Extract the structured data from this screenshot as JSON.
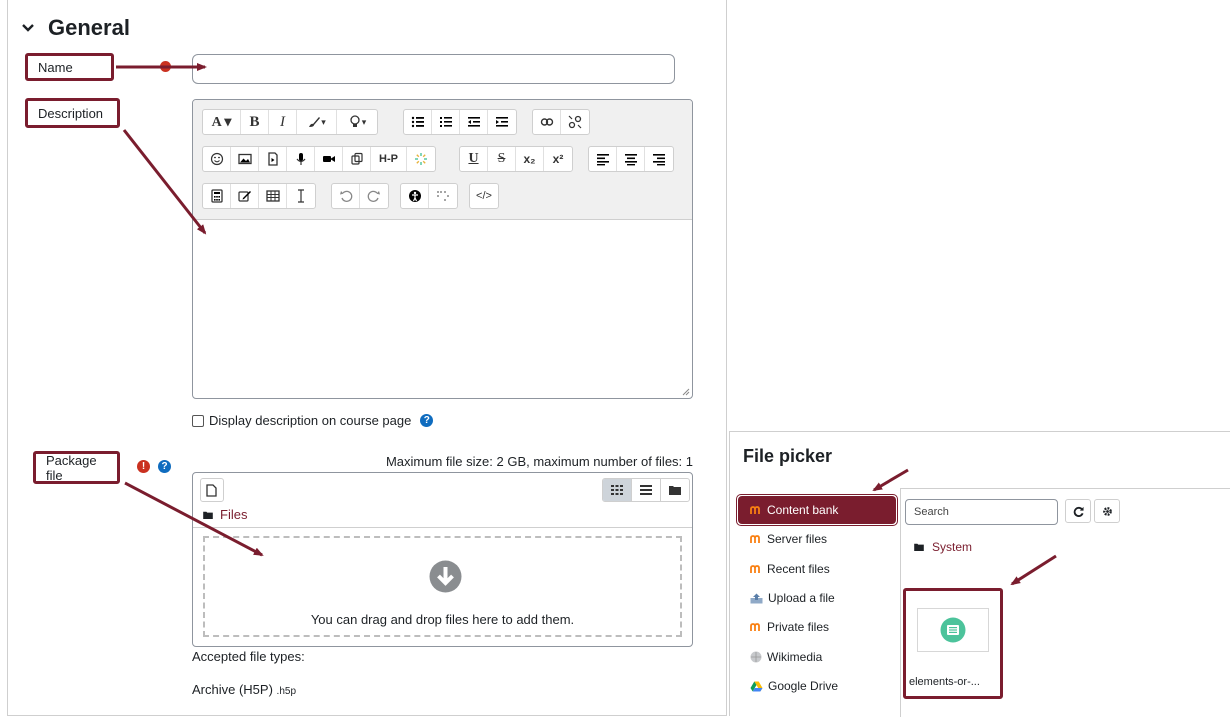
{
  "general": {
    "section_title": "General",
    "name_label": "Name",
    "name_value": "",
    "description_label": "Description",
    "display_description_label": "Display description on course page",
    "package_file_label": "Package file",
    "max_file_text": "Maximum file size: 2 GB, maximum number of files: 1",
    "files_path": "Files",
    "drop_text": "You can drag and drop files here to add them.",
    "accepted_types_label": "Accepted file types:",
    "accepted_type_name": "Archive (H5P)",
    "accepted_type_ext": ".h5p"
  },
  "editor": {
    "toolbar_row1": [
      "A▾",
      "B",
      "I",
      "✎▾",
      "⭘▾",
      "list-ul",
      "list-ol",
      "outdent",
      "indent",
      "link",
      "unlink"
    ],
    "toolbar_row2": [
      "emoji",
      "image",
      "media",
      "mic",
      "video",
      "copy",
      "H-P",
      "loading",
      "U",
      "S",
      "x₂",
      "x²",
      "align-left",
      "align-center",
      "align-right"
    ],
    "toolbar_row3": [
      "calculator",
      "edit",
      "table",
      "I",
      "undo",
      "redo",
      "accessibility",
      "braille",
      "</>"
    ],
    "h5p_label": "H-P",
    "sub_label": "x₂",
    "sup_label": "x²",
    "code_label": "</>"
  },
  "file_picker": {
    "title": "File picker",
    "repositories": [
      {
        "label": "Content bank",
        "icon": "moodle-icon",
        "active": true
      },
      {
        "label": "Server files",
        "icon": "moodle-icon",
        "active": false
      },
      {
        "label": "Recent files",
        "icon": "moodle-icon",
        "active": false
      },
      {
        "label": "Upload a file",
        "icon": "upload-icon",
        "active": false
      },
      {
        "label": "Private files",
        "icon": "moodle-icon",
        "active": false
      },
      {
        "label": "Wikimedia",
        "icon": "wikimedia-icon",
        "active": false
      },
      {
        "label": "Google Drive",
        "icon": "google-drive-icon",
        "active": false
      }
    ],
    "search_placeholder": "Search",
    "folder_system": "System",
    "file_name": "elements-or-..."
  },
  "colors": {
    "accent": "#7a1d2e",
    "required": "#ca3120",
    "help": "#0f6cbf",
    "file_icon": "#4cc39b"
  }
}
